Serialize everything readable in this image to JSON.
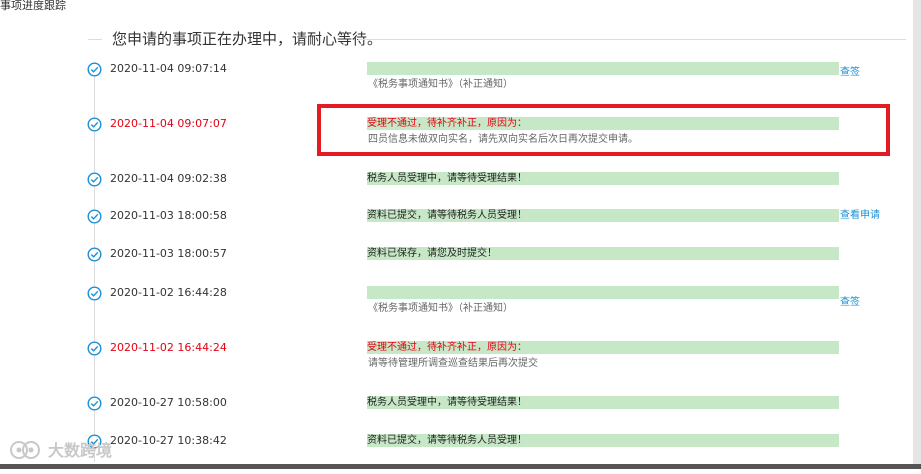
{
  "page": {
    "header_title": "事项进度跟踪"
  },
  "title": {
    "text": "您申请的事项正在办理中，请耐心等待。"
  },
  "entries": [
    {
      "time": "2020-11-04 09:07:14",
      "status": "",
      "detail": "《税务事项通知书》（补正通知）",
      "action": "查签",
      "rejected": false
    },
    {
      "time": "2020-11-04 09:07:07",
      "status": "受理不通过，待补齐补正，原因为：",
      "detail": "四员信息未做双向实名，请先双向实名后次日再次提交申请。",
      "action": "",
      "rejected": true
    },
    {
      "time": "2020-11-04 09:02:38",
      "status": "税务人员受理中，请等待受理结果！",
      "detail": "",
      "action": "",
      "rejected": false
    },
    {
      "time": "2020-11-03 18:00:58",
      "status": "资料已提交，请等待税务人员受理！",
      "detail": "",
      "action": "查看申请",
      "rejected": false
    },
    {
      "time": "2020-11-03 18:00:57",
      "status": "资料已保存，请您及时提交！",
      "detail": "",
      "action": "",
      "rejected": false
    },
    {
      "time": "2020-11-02 16:44:28",
      "status": "",
      "detail": "《税务事项通知书》（补正通知）",
      "action": "查签",
      "rejected": false
    },
    {
      "time": "2020-11-02 16:44:24",
      "status": "受理不通过，待补齐补正，原因为：",
      "detail": "请等待管理所调查巡查结果后再次提交",
      "action": "",
      "rejected": true
    },
    {
      "time": "2020-10-27 10:58:00",
      "status": "税务人员受理中，请等待受理结果！",
      "detail": "",
      "action": "",
      "rejected": false
    },
    {
      "time": "2020-10-27 10:38:42",
      "status": "资料已提交，请等待税务人员受理！",
      "detail": "",
      "action": "",
      "rejected": false
    }
  ],
  "watermark": {
    "text": "大数跨境"
  },
  "colors": {
    "accent_blue": "#1a8fd6",
    "reject_red": "#e60012",
    "status_green": "#c6e8c6",
    "highlight_border": "#e31b23"
  }
}
